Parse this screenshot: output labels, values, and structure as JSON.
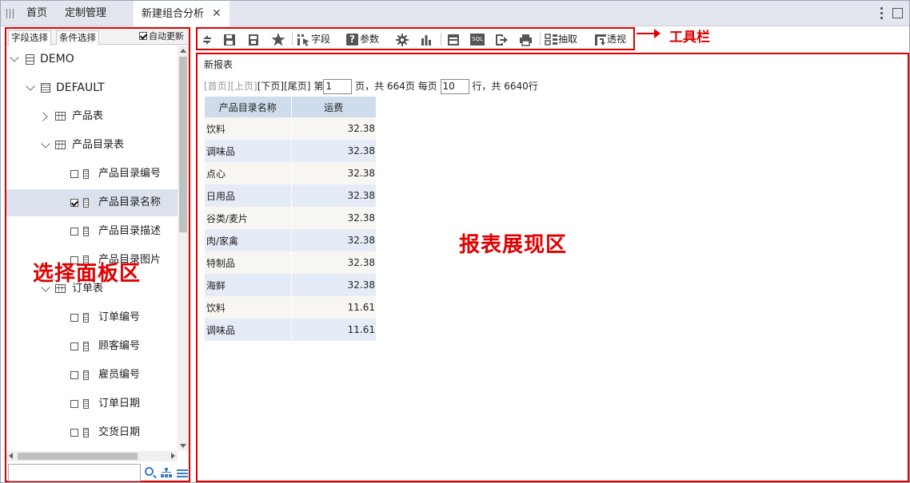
{
  "tabs": {
    "home": "首页",
    "custom": "定制管理",
    "active": "新建组合分析",
    "close": "✕"
  },
  "left_panel": {
    "tab_fields": "字段选择",
    "tab_conditions": "条件选择",
    "auto_update": "自动更新",
    "auto_update_checked": true,
    "tree": [
      {
        "label": "DEMO",
        "type": "database",
        "expanded": true
      },
      {
        "label": "DEFAULT",
        "type": "schema",
        "expanded": true
      },
      {
        "label": "产品表",
        "type": "table",
        "expanded": false
      },
      {
        "label": "产品目录表",
        "type": "table",
        "expanded": true
      },
      {
        "label": "产品目录编号",
        "type": "field",
        "checked": false
      },
      {
        "label": "产品目录名称",
        "type": "field",
        "checked": true,
        "selected": true
      },
      {
        "label": "产品目录描述",
        "type": "field",
        "checked": false
      },
      {
        "label": "产品目录图片",
        "type": "field",
        "checked": false
      },
      {
        "label": "订单表",
        "type": "table",
        "expanded": true
      },
      {
        "label": "订单编号",
        "type": "field",
        "checked": false
      },
      {
        "label": "顾客编号",
        "type": "field",
        "checked": false
      },
      {
        "label": "雇员编号",
        "type": "field",
        "checked": false
      },
      {
        "label": "订单日期",
        "type": "field",
        "checked": false
      },
      {
        "label": "交货日期",
        "type": "field",
        "checked": false
      }
    ],
    "search_value": "",
    "annotation": "选择面板区"
  },
  "toolbar": {
    "field_label": "字段",
    "param_label": "参数",
    "extract_label": "抽取",
    "pivot_label": "透视",
    "sql_label": "SQL",
    "annotation": "工具栏"
  },
  "report": {
    "title": "新报表",
    "pager": {
      "first": "[首页]",
      "prev": "[上页]",
      "next": "[下页]",
      "last": "[尾页]",
      "page_prefix": "第",
      "page_value": "1",
      "page_suffix": "页，共 664页 每页",
      "per_page_value": "10",
      "rows_suffix": "行，共 6640行"
    },
    "columns": [
      "产品目录名称",
      "运费"
    ],
    "rows": [
      [
        "饮料",
        "32.38"
      ],
      [
        "调味品",
        "32.38"
      ],
      [
        "点心",
        "32.38"
      ],
      [
        "日用品",
        "32.38"
      ],
      [
        "谷类/麦片",
        "32.38"
      ],
      [
        "肉/家禽",
        "32.38"
      ],
      [
        "特制品",
        "32.38"
      ],
      [
        "海鲜",
        "32.38"
      ],
      [
        "饮料",
        "11.61"
      ],
      [
        "调味品",
        "11.61"
      ]
    ],
    "annotation": "报表展现区"
  },
  "colors": {
    "annotation_red": "#e00000",
    "header_blue": "#cfdcec",
    "row_alt": "#e6ebf8",
    "icon_blue": "#3b7bc8"
  }
}
